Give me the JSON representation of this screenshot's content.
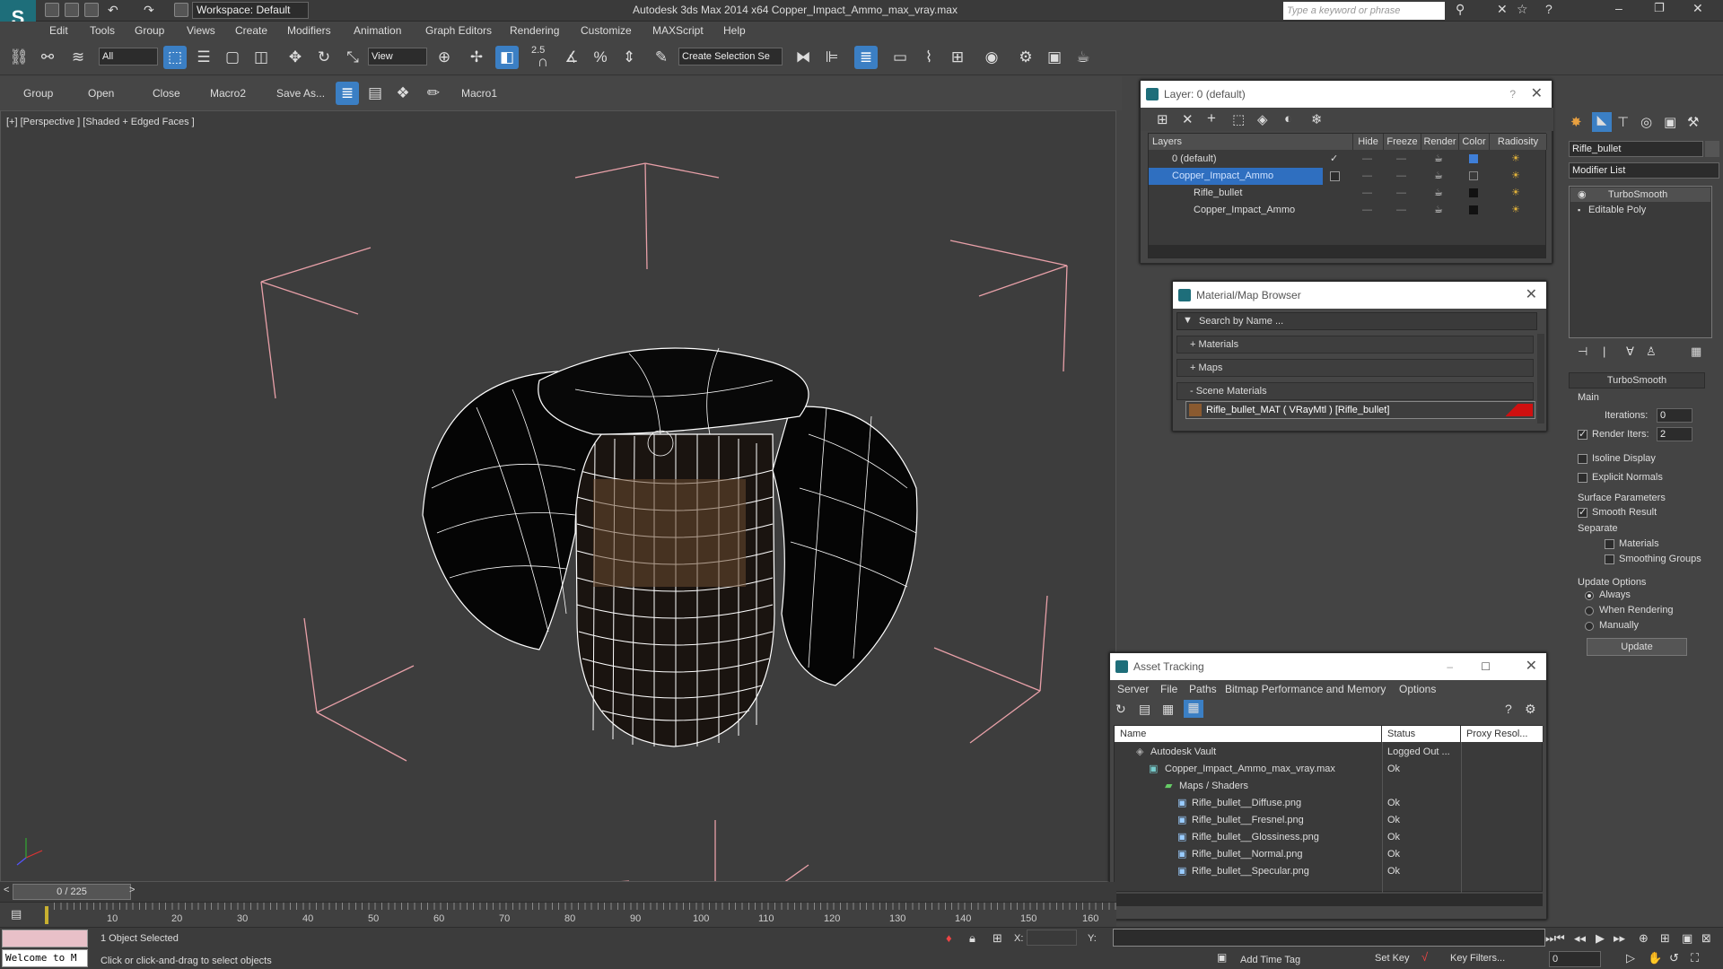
{
  "app": {
    "title": "Autodesk 3ds Max  2014 x64     Copper_Impact_Ammo_max_vray.max",
    "workspace": "Workspace: Default",
    "search_placeholder": "Type a keyword or phrase"
  },
  "menu": [
    "Edit",
    "Tools",
    "Group",
    "Views",
    "Create",
    "Modifiers",
    "Animation",
    "Graph Editors",
    "Rendering",
    "Customize",
    "MAXScript",
    "Help"
  ],
  "toolbar": {
    "selection_filter": "All",
    "ref_coord": "View",
    "snap_value": "2.5",
    "named_selection": "Create Selection Se"
  },
  "shelf": {
    "group": "Group",
    "open": "Open",
    "close": "Close",
    "macro2": "Macro2",
    "save_as": "Save As...",
    "macro1": "Macro1"
  },
  "viewport": {
    "label": "[+] [Perspective ] [Shaded + Edged Faces ]"
  },
  "layer_panel": {
    "title": "Layer: 0 (default)",
    "help": "?",
    "columns": [
      "Layers",
      "Hide",
      "Freeze",
      "Render",
      "Color",
      "Radiosity"
    ],
    "rows": [
      {
        "name": "0 (default)",
        "color": "#3f7fd8"
      },
      {
        "name": "Copper_Impact_Ammo",
        "color": "#3a3a3a"
      },
      {
        "name": "Rifle_bullet",
        "color": "#111111"
      },
      {
        "name": "Copper_Impact_Ammo",
        "color": "#111111"
      }
    ]
  },
  "material_browser": {
    "title": "Material/Map Browser",
    "search_placeholder": "Search by Name ...",
    "sections": [
      "+ Materials",
      "+ Maps",
      "- Scene Materials"
    ],
    "scene_item": "Rifle_bullet_MAT  ( VRayMtl )  [Rifle_bullet]"
  },
  "asset_tracking": {
    "title": "Asset Tracking",
    "menu": [
      "Server",
      "File",
      "Paths",
      "Bitmap Performance and Memory",
      "Options"
    ],
    "columns": [
      "Name",
      "Status",
      "Proxy Resol..."
    ],
    "rows": [
      {
        "name": "Autodesk Vault",
        "status": "Logged Out ..."
      },
      {
        "name": "Copper_Impact_Ammo_max_vray.max",
        "status": "Ok"
      },
      {
        "name": "Maps / Shaders",
        "status": ""
      },
      {
        "name": "Rifle_bullet__Diffuse.png",
        "status": "Ok"
      },
      {
        "name": "Rifle_bullet__Fresnel.png",
        "status": "Ok"
      },
      {
        "name": "Rifle_bullet__Glossiness.png",
        "status": "Ok"
      },
      {
        "name": "Rifle_bullet__Normal.png",
        "status": "Ok"
      },
      {
        "name": "Rifle_bullet__Specular.png",
        "status": "Ok"
      }
    ]
  },
  "command_panel": {
    "object_name": "Rifle_bullet",
    "modifier_list": "Modifier List",
    "stack": [
      "TurboSmooth",
      "Editable Poly"
    ],
    "rollout": "TurboSmooth",
    "main": "Main",
    "iterations_label": "Iterations:",
    "iterations": "0",
    "render_iters_label": "Render Iters:",
    "render_iters": "2",
    "isoline": "Isoline Display",
    "explicit_normals": "Explicit Normals",
    "surface_params": "Surface Parameters",
    "smooth_result": "Smooth Result",
    "separate": "Separate",
    "materials": "Materials",
    "smoothing_groups": "Smoothing Groups",
    "update_options": "Update Options",
    "always": "Always",
    "when_rendering": "When Rendering",
    "manually": "Manually",
    "update": "Update"
  },
  "timeline": {
    "frame": "0 / 225",
    "ticks": [
      "10",
      "20",
      "30",
      "40",
      "50",
      "60",
      "70",
      "80",
      "90",
      "100",
      "110",
      "120",
      "130",
      "140",
      "150",
      "160"
    ]
  },
  "status": {
    "welcome": "Welcome to M",
    "selected": "1 Object Selected",
    "prompt": "Click or click-and-drag to select objects",
    "x_label": "X:",
    "y_label": "Y:",
    "add_time_tag": "Add Time Tag",
    "set_key": "Set Key",
    "key_filters": "Key Filters...",
    "frame_field": "0"
  }
}
